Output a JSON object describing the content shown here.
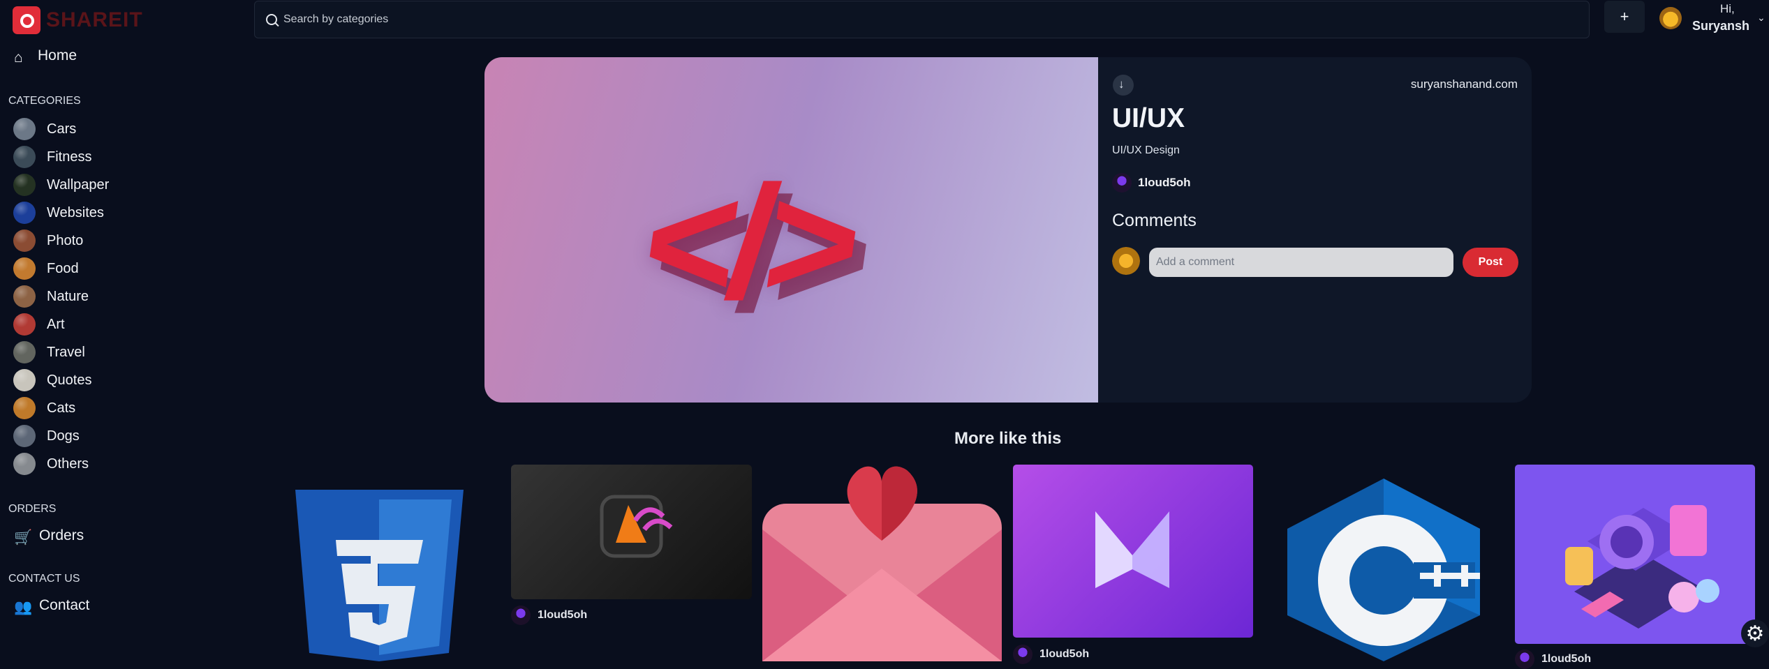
{
  "brand": {
    "name": "SHAREIT"
  },
  "nav": {
    "home": "Home",
    "categories_title": "CATEGORIES",
    "orders_title": "ORDERS",
    "orders": "Orders",
    "contact_title": "CONTACT US",
    "contact": "Contact"
  },
  "categories": [
    {
      "label": "Cars",
      "color": "#6c7887"
    },
    {
      "label": "Fitness",
      "color": "#3b4b58"
    },
    {
      "label": "Wallpaper",
      "color": "#243222"
    },
    {
      "label": "Websites",
      "color": "#1c3f9a"
    },
    {
      "label": "Photo",
      "color": "#8b4c33"
    },
    {
      "label": "Food",
      "color": "#c27a2f"
    },
    {
      "label": "Nature",
      "color": "#8d6345"
    },
    {
      "label": "Art",
      "color": "#b13a34"
    },
    {
      "label": "Travel",
      "color": "#62655f"
    },
    {
      "label": "Quotes",
      "color": "#c8c5bc"
    },
    {
      "label": "Cats",
      "color": "#c07a2a"
    },
    {
      "label": "Dogs",
      "color": "#5d6777"
    },
    {
      "label": "Others",
      "color": "#868a8f"
    }
  ],
  "search": {
    "placeholder": "Search by categories"
  },
  "top_actions": {
    "add": "+"
  },
  "user": {
    "greeting": "Hi,",
    "name": "Suryansh"
  },
  "pin": {
    "site": "suryanshanand.com",
    "title": "UI/UX",
    "description": "UI/UX Design",
    "author": "1loud5oh",
    "hero_glyph": "</>"
  },
  "comments": {
    "title": "Comments",
    "placeholder": "Add a comment",
    "button": "Post"
  },
  "more": {
    "title": "More like this",
    "items": [
      {
        "author": "1loud5oh"
      },
      {
        "author": "1loud5oh"
      },
      {
        "author": "1loud5oh"
      }
    ]
  },
  "colors": {
    "background": "#090e1d",
    "panel": "#0f1728",
    "accent": "#d92b33"
  }
}
